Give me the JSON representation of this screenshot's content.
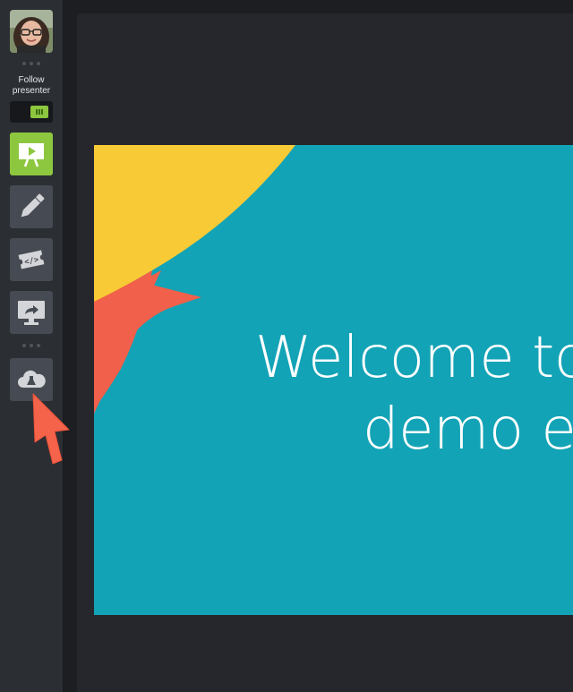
{
  "sidebar": {
    "follow_presenter_label": "Follow presenter",
    "follow_presenter_on": true,
    "tools": [
      {
        "name": "presentation-icon",
        "active": true
      },
      {
        "name": "pen-icon",
        "active": false
      },
      {
        "name": "embed-code-icon",
        "active": false
      },
      {
        "name": "screen-share-icon",
        "active": false
      },
      {
        "name": "cloud-flask-icon",
        "active": false
      }
    ]
  },
  "slide": {
    "title_line1": "Welcome to",
    "title_line2": "demo ev"
  },
  "colors": {
    "accent": "#8dc63f",
    "slide_bg": "#13a3b6",
    "slide_yellow": "#f8ca35",
    "slide_red": "#f0604a",
    "cursor": "#f4634a"
  }
}
